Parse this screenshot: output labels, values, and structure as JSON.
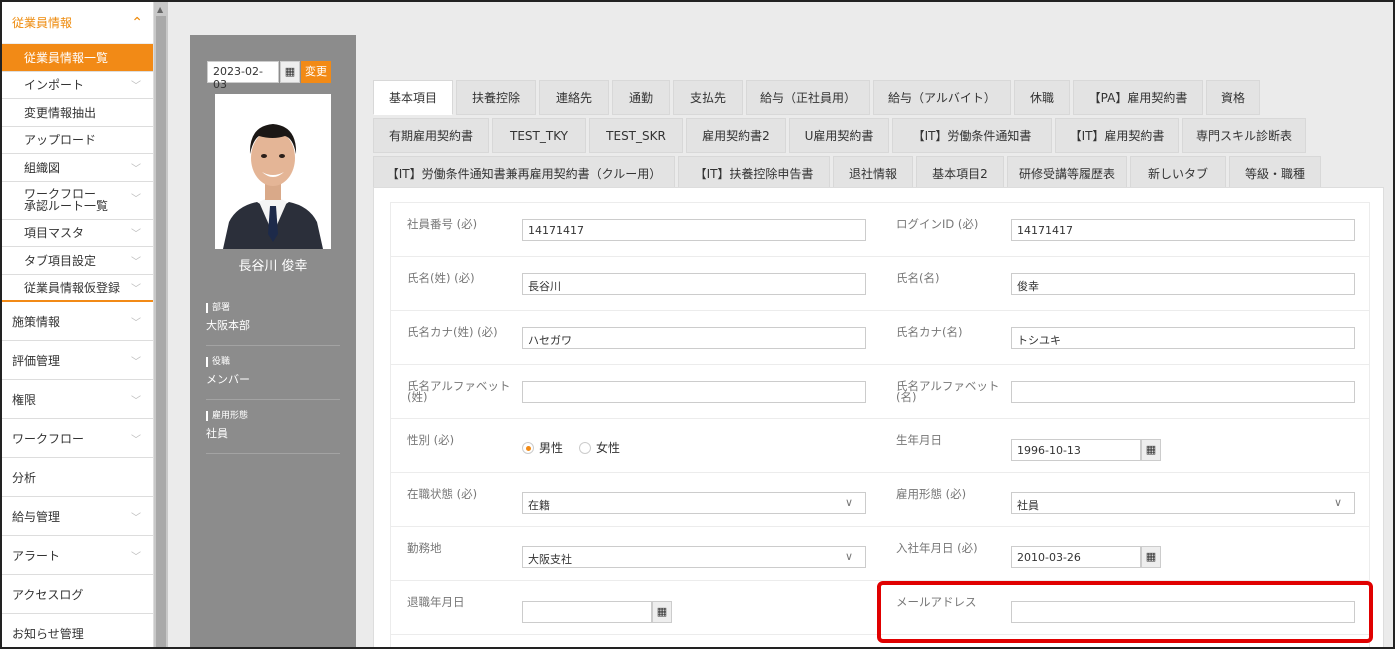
{
  "sidebar": {
    "section_title": "従業員情報",
    "sub_items": [
      {
        "label": "従業員情報一覧",
        "active": true
      },
      {
        "label": "インポート"
      },
      {
        "label": "変更情報抽出"
      },
      {
        "label": "アップロード"
      },
      {
        "label": "組織図"
      },
      {
        "label": "ワークフロー承認ルート一覧",
        "line1": "ワークフロー",
        "line2": "承認ルート一覧"
      },
      {
        "label": "項目マスタ"
      },
      {
        "label": "タブ項目設定"
      },
      {
        "label": "従業員情報仮登録"
      }
    ],
    "main_items": [
      {
        "label": "施策情報"
      },
      {
        "label": "評価管理"
      },
      {
        "label": "権限"
      },
      {
        "label": "ワークフロー"
      },
      {
        "label": "分析"
      },
      {
        "label": "給与管理"
      },
      {
        "label": "アラート"
      },
      {
        "label": "アクセスログ"
      },
      {
        "label": "お知らせ管理"
      }
    ]
  },
  "profile": {
    "date_value": "2023-02-03",
    "change_button": "変更",
    "name": "長谷川 俊幸",
    "fields": [
      {
        "label": "部署",
        "value": "大阪本部"
      },
      {
        "label": "役職",
        "value": "メンバー"
      },
      {
        "label": "雇用形態",
        "value": "社員"
      }
    ]
  },
  "tabs": {
    "row1": [
      "基本項目",
      "扶養控除",
      "連絡先",
      "通勤",
      "支払先",
      "給与（正社員用）",
      "給与（アルバイト）",
      "休職",
      "【PA】雇用契約書",
      "資格"
    ],
    "row2": [
      "有期雇用契約書",
      "TEST_TKY",
      "TEST_SKR",
      "雇用契約書2",
      "U雇用契約書",
      "【IT】労働条件通知書",
      "【IT】雇用契約書",
      "専門スキル診断表"
    ],
    "row3": [
      "【IT】労働条件通知書兼再雇用契約書（クルー用）",
      "【IT】扶養控除申告書",
      "退社情報",
      "基本項目2",
      "研修受講等履歴表",
      "新しいタブ",
      "等級・職種"
    ]
  },
  "form": {
    "employee_no_label": "社員番号 (必)",
    "employee_no": "14171417",
    "login_id_label": "ログインID (必)",
    "login_id": "14171417",
    "last_name_label": "氏名(姓) (必)",
    "last_name": "長谷川",
    "first_name_label": "氏名(名)",
    "first_name": "俊幸",
    "last_kana_label": "氏名カナ(姓) (必)",
    "last_kana": "ハセガワ",
    "first_kana_label": "氏名カナ(名)",
    "first_kana": "トシユキ",
    "last_alpha_label_1": "氏名アルファベット",
    "last_alpha_label_2": "(姓)",
    "last_alpha": "",
    "first_alpha_label_1": "氏名アルファベット",
    "first_alpha_label_2": "(名)",
    "first_alpha": "",
    "gender_label": "性別 (必)",
    "gender_male": "男性",
    "gender_female": "女性",
    "birthdate_label": "生年月日",
    "birthdate": "1996-10-13",
    "status_label": "在職状態 (必)",
    "status": "在籍",
    "employment_label": "雇用形態 (必)",
    "employment": "社員",
    "workplace_label": "勤務地",
    "workplace": "大阪支社",
    "join_date_label": "入社年月日 (必)",
    "join_date": "2010-03-26",
    "leave_date_label": "退職年月日",
    "leave_date": "",
    "email_label": "メールアドレス",
    "email": ""
  },
  "icons": {
    "calendar": "calendar-icon",
    "chevron": "chevron-down-icon",
    "accent_color": "#f28a16",
    "highlight_color": "#e00000"
  }
}
